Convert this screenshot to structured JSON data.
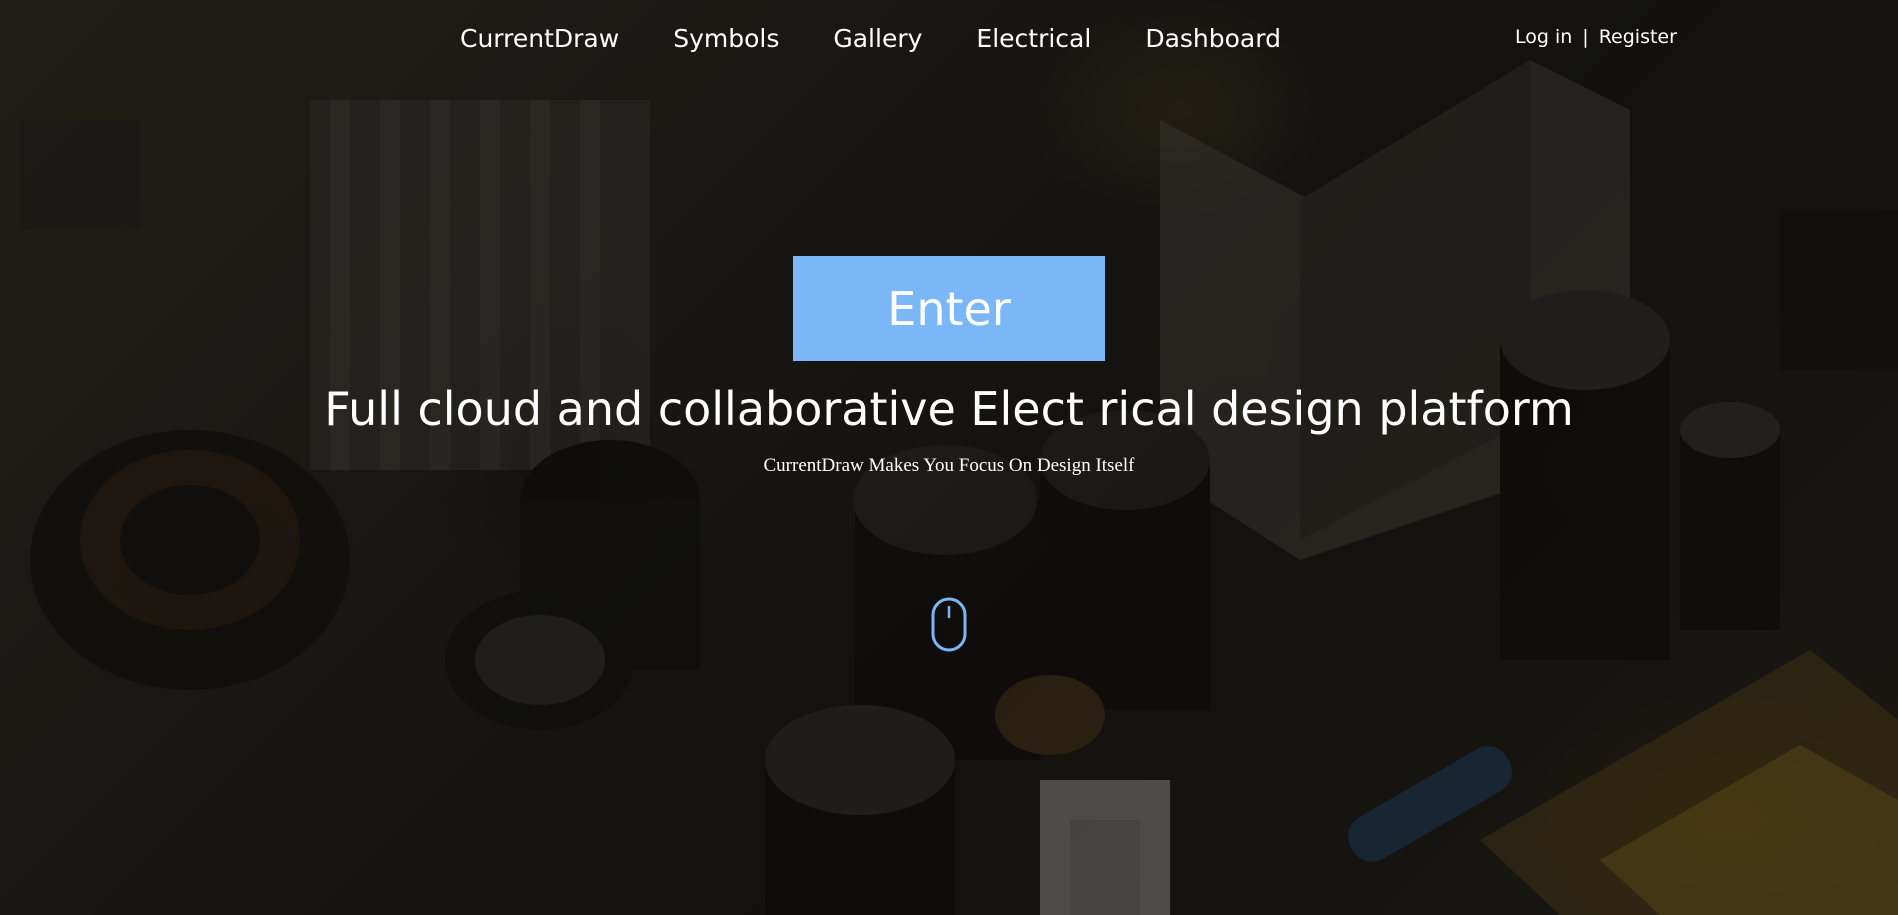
{
  "nav": {
    "items": [
      {
        "label": "CurrentDraw"
      },
      {
        "label": "Symbols"
      },
      {
        "label": "Gallery"
      },
      {
        "label": "Electrical"
      },
      {
        "label": "Dashboard"
      }
    ]
  },
  "auth": {
    "login": "Log in",
    "separator": "|",
    "register": "Register"
  },
  "hero": {
    "button_label": "Enter",
    "headline": "Full cloud and collaborative Elect rical design platform",
    "subheadline": "CurrentDraw Makes You Focus On Design Itself"
  },
  "theme": {
    "accent": "#7bb7f7",
    "icon": "mouse-scroll-icon"
  }
}
